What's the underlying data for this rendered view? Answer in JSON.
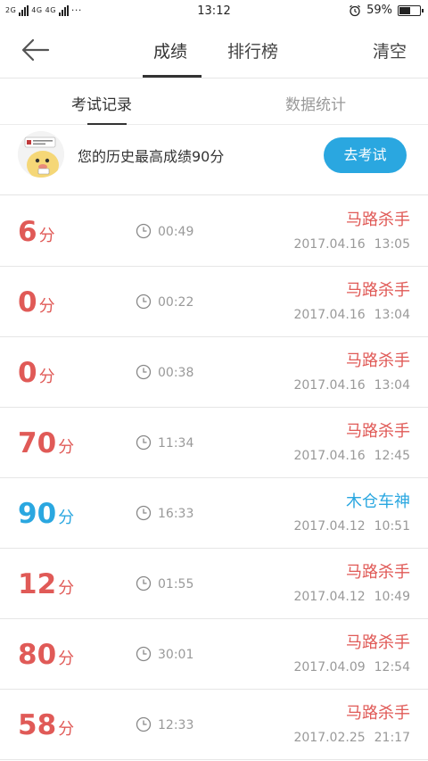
{
  "status_bar": {
    "left_text_1": "2G",
    "left_text_2": "4G 4G",
    "left_dots": "···",
    "time": "13:12",
    "alarm_icon": "alarm-clock-icon",
    "battery_percent": "59%",
    "battery_level": 0.59
  },
  "header": {
    "back_icon": "arrow-left-icon",
    "tab_score": "成绩",
    "tab_rank": "排行榜",
    "clear_label": "清空"
  },
  "subtabs": {
    "records": "考试记录",
    "stats": "数据统计"
  },
  "best": {
    "avatar_icon": "cartoon-avatar-icon",
    "text": "您的历史最高成绩90分",
    "go_button": "去考试"
  },
  "records": [
    {
      "score": "6",
      "unit": "分",
      "duration": "00:49",
      "title": "马路杀手",
      "date": "2017.04.16",
      "time": "13:05"
    },
    {
      "score": "0",
      "unit": "分",
      "duration": "00:22",
      "title": "马路杀手",
      "date": "2017.04.16",
      "time": "13:04"
    },
    {
      "score": "0",
      "unit": "分",
      "duration": "00:38",
      "title": "马路杀手",
      "date": "2017.04.16",
      "time": "13:04"
    },
    {
      "score": "70",
      "unit": "分",
      "duration": "11:34",
      "title": "马路杀手",
      "date": "2017.04.16",
      "time": "12:45"
    },
    {
      "score": "90",
      "unit": "分",
      "duration": "16:33",
      "title": "木仓车神",
      "date": "2017.04.12",
      "time": "10:51"
    },
    {
      "score": "12",
      "unit": "分",
      "duration": "01:55",
      "title": "马路杀手",
      "date": "2017.04.12",
      "time": "10:49"
    },
    {
      "score": "80",
      "unit": "分",
      "duration": "30:01",
      "title": "马路杀手",
      "date": "2017.04.09",
      "time": "12:54"
    },
    {
      "score": "58",
      "unit": "分",
      "duration": "12:33",
      "title": "马路杀手",
      "date": "2017.02.25",
      "time": "21:17"
    }
  ],
  "colors": {
    "fail": "#e05a57",
    "pass": "#2aa7e0"
  }
}
